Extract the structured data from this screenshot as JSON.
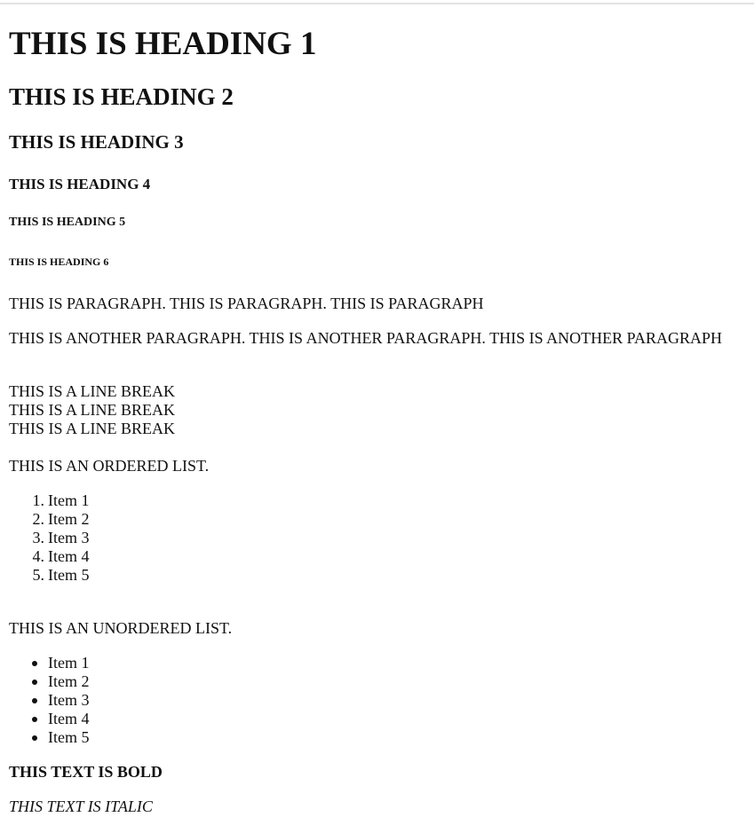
{
  "headings": {
    "h1": "THIS IS HEADING 1",
    "h2": "THIS IS HEADING 2",
    "h3": "THIS IS HEADING 3",
    "h4": "THIS IS HEADING 4",
    "h5": "THIS IS HEADING 5",
    "h6": "THIS IS HEADING 6"
  },
  "paragraphs": [
    "THIS IS PARAGRAPH. THIS IS PARAGRAPH. THIS IS PARAGRAPH",
    "THIS IS ANOTHER PARAGRAPH. THIS IS ANOTHER PARAGRAPH. THIS IS ANOTHER PARAGRAPH"
  ],
  "line_breaks": [
    "THIS IS A LINE BREAK",
    "THIS IS A LINE BREAK",
    "THIS IS A LINE BREAK"
  ],
  "ordered_list": {
    "label": "THIS IS AN ORDERED LIST.",
    "markers": [
      "1.",
      "2.",
      "3.",
      "4.",
      "5."
    ],
    "items": [
      "Item 1",
      "Item 2",
      "Item 3",
      "Item 4",
      "Item 5"
    ]
  },
  "unordered_list": {
    "label": "THIS IS AN UNORDERED LIST.",
    "items": [
      "Item 1",
      "Item 2",
      "Item 3",
      "Item 4",
      "Item 5"
    ]
  },
  "bold_text": "THIS TEXT IS BOLD",
  "italic_text": "THIS TEXT IS ITALIC"
}
